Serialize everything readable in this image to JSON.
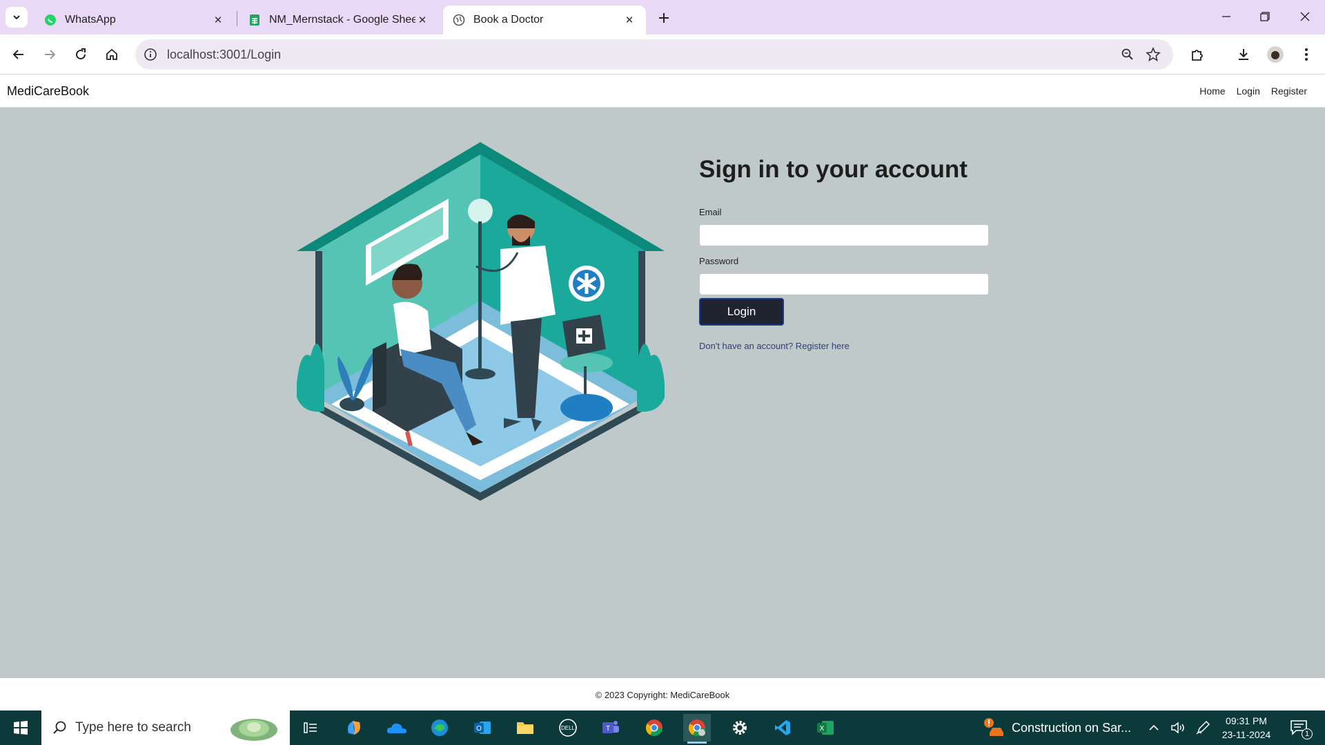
{
  "browser": {
    "tabs": [
      {
        "title": "WhatsApp",
        "icon": "whatsapp-icon",
        "active": false
      },
      {
        "title": "NM_Mernstack - Google Sheets",
        "icon": "google-sheets-icon",
        "active": false
      },
      {
        "title": "Book a Doctor",
        "icon": "globe-icon",
        "active": true
      }
    ],
    "url": "localhost:3001/Login"
  },
  "app": {
    "brand": "MediCareBook",
    "nav": {
      "home": "Home",
      "login": "Login",
      "register": "Register"
    },
    "form": {
      "title": "Sign in to your account",
      "email_label": "Email",
      "email_value": "",
      "password_label": "Password",
      "password_value": "",
      "login_button": "Login",
      "register_link": "Don't have an account? Register here"
    },
    "footer": "© 2023 Copyright: MediCareBook"
  },
  "taskbar": {
    "search_placeholder": "Type here to search",
    "news": "Construction on Sar...",
    "time": "09:31 PM",
    "date": "23-11-2024",
    "notifications": "1",
    "apps": [
      "task-view-icon",
      "copilot-icon",
      "onedrive-icon",
      "edge-icon",
      "outlook-icon",
      "file-explorer-icon",
      "dell-icon",
      "teams-icon",
      "chrome-icon",
      "chrome-profile-icon",
      "settings-icon",
      "vscode-icon",
      "excel-icon"
    ]
  },
  "colors": {
    "tabstrip": "#e9d8f6",
    "page_background": "#bfc9c9",
    "login_button": "#1f2430",
    "taskbar": "#0c3a3b",
    "illustration_teal": "#1aa99a"
  }
}
